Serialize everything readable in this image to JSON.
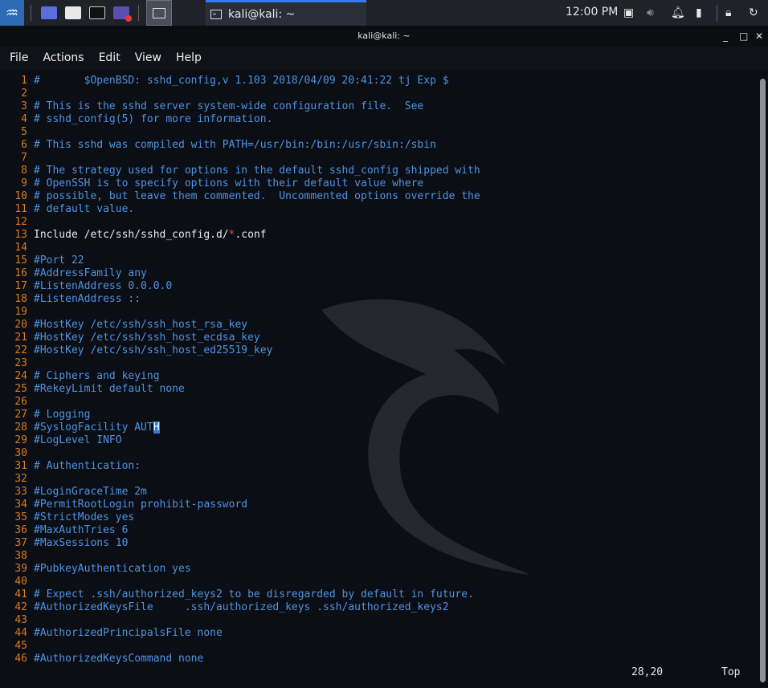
{
  "panel": {
    "clock": "12:00 PM",
    "task_label": "kali@kali: ~"
  },
  "window": {
    "title": "kali@kali: ~",
    "controls": {
      "minimize": "_",
      "maximize": "□",
      "close": "✕"
    }
  },
  "menu": [
    "File",
    "Actions",
    "Edit",
    "View",
    "Help"
  ],
  "editor": {
    "lines": [
      {
        "n": "1",
        "t": "#       $OpenBSD: sshd_config,v 1.103 2018/04/09 20:41:22 tj Exp $",
        "c": "cm"
      },
      {
        "n": "2",
        "t": "",
        "c": "cm"
      },
      {
        "n": "3",
        "t": "# This is the sshd server system-wide configuration file.  See",
        "c": "cm"
      },
      {
        "n": "4",
        "t": "# sshd_config(5) for more information.",
        "c": "cm"
      },
      {
        "n": "5",
        "t": "",
        "c": "cm"
      },
      {
        "n": "6",
        "t": "# This sshd was compiled with PATH=/usr/bin:/bin:/usr/sbin:/sbin",
        "c": "cm"
      },
      {
        "n": "7",
        "t": "",
        "c": "cm"
      },
      {
        "n": "8",
        "t": "# The strategy used for options in the default sshd_config shipped with",
        "c": "cm"
      },
      {
        "n": "9",
        "t": "# OpenSSH is to specify options with their default value where",
        "c": "cm"
      },
      {
        "n": "10",
        "t": "# possible, but leave them commented.  Uncommented options override the",
        "c": "cm"
      },
      {
        "n": "11",
        "t": "# default value.",
        "c": "cm"
      },
      {
        "n": "12",
        "t": "",
        "c": "cm"
      },
      {
        "n": "13",
        "t": "",
        "c": "include"
      },
      {
        "n": "14",
        "t": "",
        "c": "cm"
      },
      {
        "n": "15",
        "t": "#Port 22",
        "c": "cm"
      },
      {
        "n": "16",
        "t": "#AddressFamily any",
        "c": "cm"
      },
      {
        "n": "17",
        "t": "#ListenAddress 0.0.0.0",
        "c": "cm"
      },
      {
        "n": "18",
        "t": "#ListenAddress ::",
        "c": "cm"
      },
      {
        "n": "19",
        "t": "",
        "c": "cm"
      },
      {
        "n": "20",
        "t": "#HostKey /etc/ssh/ssh_host_rsa_key",
        "c": "cm"
      },
      {
        "n": "21",
        "t": "#HostKey /etc/ssh/ssh_host_ecdsa_key",
        "c": "cm"
      },
      {
        "n": "22",
        "t": "#HostKey /etc/ssh/ssh_host_ed25519_key",
        "c": "cm"
      },
      {
        "n": "23",
        "t": "",
        "c": "cm"
      },
      {
        "n": "24",
        "t": "# Ciphers and keying",
        "c": "cm"
      },
      {
        "n": "25",
        "t": "#RekeyLimit default none",
        "c": "cm"
      },
      {
        "n": "26",
        "t": "",
        "c": "cm"
      },
      {
        "n": "27",
        "t": "# Logging",
        "c": "cm"
      },
      {
        "n": "28",
        "t": "",
        "c": "cursorline"
      },
      {
        "n": "29",
        "t": "#LogLevel INFO",
        "c": "cm"
      },
      {
        "n": "30",
        "t": "",
        "c": "cm"
      },
      {
        "n": "31",
        "t": "# Authentication:",
        "c": "cm"
      },
      {
        "n": "32",
        "t": "",
        "c": "cm"
      },
      {
        "n": "33",
        "t": "#LoginGraceTime 2m",
        "c": "cm"
      },
      {
        "n": "34",
        "t": "#PermitRootLogin prohibit-password",
        "c": "cm"
      },
      {
        "n": "35",
        "t": "#StrictModes yes",
        "c": "cm"
      },
      {
        "n": "36",
        "t": "#MaxAuthTries 6",
        "c": "cm"
      },
      {
        "n": "37",
        "t": "#MaxSessions 10",
        "c": "cm"
      },
      {
        "n": "38",
        "t": "",
        "c": "cm"
      },
      {
        "n": "39",
        "t": "#PubkeyAuthentication yes",
        "c": "cm"
      },
      {
        "n": "40",
        "t": "",
        "c": "cm"
      },
      {
        "n": "41",
        "t": "# Expect .ssh/authorized_keys2 to be disregarded by default in future.",
        "c": "cm"
      },
      {
        "n": "42",
        "t": "#AuthorizedKeysFile     .ssh/authorized_keys .ssh/authorized_keys2",
        "c": "cm"
      },
      {
        "n": "43",
        "t": "",
        "c": "cm"
      },
      {
        "n": "44",
        "t": "#AuthorizedPrincipalsFile none",
        "c": "cm"
      },
      {
        "n": "45",
        "t": "",
        "c": "cm"
      },
      {
        "n": "46",
        "t": "#AuthorizedKeysCommand none",
        "c": "cm"
      }
    ],
    "include_line": {
      "before": "Include /etc/ssh/sshd_config.d/",
      "star": "*",
      "after": ".conf"
    },
    "cursor_line": {
      "before": "#SyslogFacility AUT",
      "cursor": "H"
    },
    "status": {
      "position": "28,20",
      "scroll": "Top"
    }
  },
  "colors": {
    "comment": "#4e93e3",
    "line_number": "#d97a1c",
    "accent": "#367bf0"
  }
}
